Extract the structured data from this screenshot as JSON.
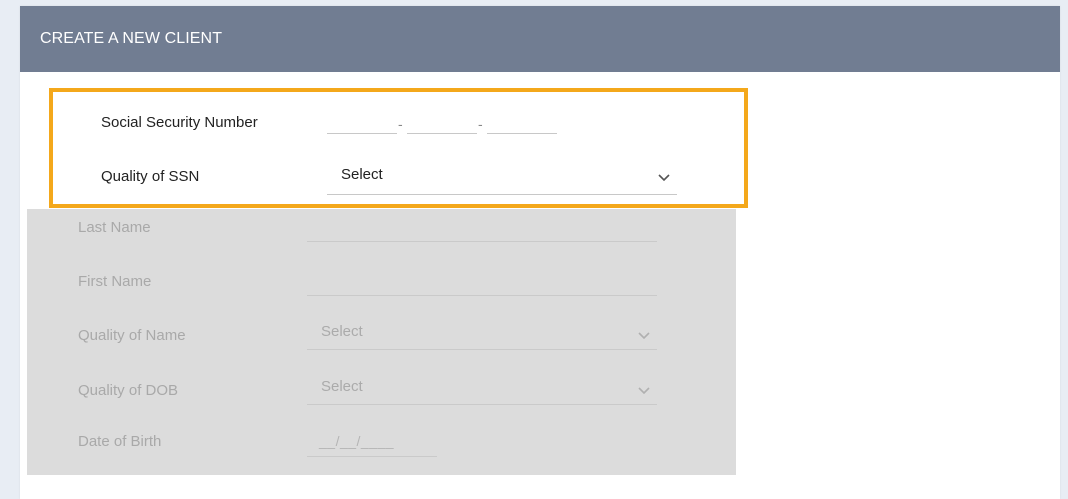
{
  "header": {
    "title": "CREATE A NEW CLIENT"
  },
  "ssn": {
    "label": "Social Security Number",
    "separator": "-"
  },
  "quality_of_ssn": {
    "label": "Quality of SSN",
    "value": "Select"
  },
  "disabled_fields": {
    "last_name": {
      "label": "Last Name"
    },
    "first_name": {
      "label": "First Name"
    },
    "quality_of_name": {
      "label": "Quality of Name",
      "value": "Select"
    },
    "quality_of_dob": {
      "label": "Quality of DOB",
      "value": "Select"
    },
    "date_of_birth": {
      "label": "Date of Birth",
      "mask": "__/__/____"
    }
  },
  "colors": {
    "header_bg": "#717d92",
    "highlight_border": "#f4a81b",
    "disabled_bg": "#dcdcdc"
  },
  "icons": {
    "dropdown": "chevron-down-icon"
  }
}
